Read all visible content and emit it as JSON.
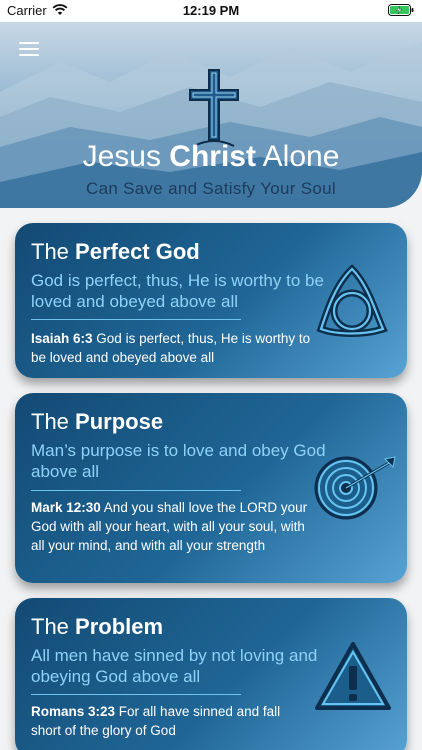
{
  "status_bar": {
    "carrier": "Carrier",
    "time": "12:19 PM"
  },
  "hero": {
    "title_part1": "Jesus ",
    "title_bold": "Christ",
    "title_part2": " Alone",
    "subtitle": "Can Save and Satisfy Your Soul"
  },
  "cards": [
    {
      "title_prefix": "The ",
      "title_bold": "Perfect God",
      "lead": "God is perfect, thus, He is worthy to be loved and obeyed above all",
      "verse_ref": "Isaiah 6:3",
      "verse_text": " God is perfect, thus, He is worthy to be loved and obeyed above all",
      "icon": "trinity-knot-icon"
    },
    {
      "title_prefix": "The ",
      "title_bold": "Purpose",
      "lead": "Man’s purpose is to love and obey God above all",
      "verse_ref": "Mark 12:30",
      "verse_text": " And you shall love the LORD your God with all your heart, with all your soul, with all your mind, and with all your strength",
      "icon": "target-arrow-icon"
    },
    {
      "title_prefix": "The ",
      "title_bold": "Problem",
      "lead": "All men have sinned by not loving and obeying God above all",
      "verse_ref": "Romans 3:23",
      "verse_text": " For all have sinned and fall short of the glory of God",
      "icon": "warning-triangle-icon"
    }
  ],
  "colors": {
    "card_gradient_start": "#134a74",
    "card_gradient_end": "#57a3d4",
    "lead_text": "#8fd2f7",
    "icon_fill": "#1b5e8c",
    "icon_stroke": "#67c4f0"
  }
}
